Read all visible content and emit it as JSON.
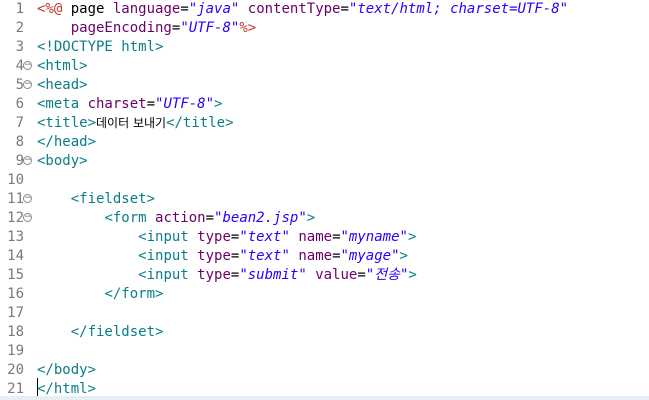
{
  "editor": {
    "lines": [
      {
        "n": "1",
        "fold": false,
        "tokens": [
          [
            "dir",
            "<%@"
          ],
          [
            "txt",
            " page "
          ],
          [
            "attr",
            "language"
          ],
          [
            "txt",
            "="
          ],
          [
            "str",
            "\"java\""
          ],
          [
            "txt",
            " "
          ],
          [
            "attr",
            "contentType"
          ],
          [
            "txt",
            "="
          ],
          [
            "str",
            "\"text/html; charset=UTF-8\""
          ]
        ]
      },
      {
        "n": "2",
        "fold": false,
        "tokens": [
          [
            "txt",
            "    "
          ],
          [
            "attr",
            "pageEncoding"
          ],
          [
            "txt",
            "="
          ],
          [
            "str",
            "\"UTF-8\""
          ],
          [
            "dir",
            "%>"
          ]
        ]
      },
      {
        "n": "3",
        "fold": false,
        "tokens": [
          [
            "tag",
            "<!DOCTYPE html>"
          ]
        ]
      },
      {
        "n": "4",
        "fold": true,
        "tokens": [
          [
            "tag",
            "<html>"
          ]
        ]
      },
      {
        "n": "5",
        "fold": true,
        "tokens": [
          [
            "tag",
            "<head>"
          ]
        ]
      },
      {
        "n": "6",
        "fold": false,
        "tokens": [
          [
            "tag",
            "<meta "
          ],
          [
            "attr",
            "charset"
          ],
          [
            "txt",
            "="
          ],
          [
            "str",
            "\"UTF-8\""
          ],
          [
            "tag",
            ">"
          ]
        ]
      },
      {
        "n": "7",
        "fold": false,
        "tokens": [
          [
            "tag",
            "<title>"
          ],
          [
            "kor",
            "데이터 보내기"
          ],
          [
            "tag",
            "</title>"
          ]
        ]
      },
      {
        "n": "8",
        "fold": false,
        "tokens": [
          [
            "tag",
            "</head>"
          ]
        ]
      },
      {
        "n": "9",
        "fold": true,
        "tokens": [
          [
            "tag",
            "<body>"
          ]
        ]
      },
      {
        "n": "10",
        "fold": false,
        "tokens": []
      },
      {
        "n": "11",
        "fold": true,
        "tokens": [
          [
            "txt",
            "    "
          ],
          [
            "tag",
            "<fieldset>"
          ]
        ]
      },
      {
        "n": "12",
        "fold": true,
        "tokens": [
          [
            "txt",
            "        "
          ],
          [
            "tag",
            "<form "
          ],
          [
            "attr",
            "action"
          ],
          [
            "txt",
            "="
          ],
          [
            "str",
            "\"bean2.jsp\""
          ],
          [
            "tag",
            ">"
          ]
        ]
      },
      {
        "n": "13",
        "fold": false,
        "tokens": [
          [
            "txt",
            "            "
          ],
          [
            "tag",
            "<input "
          ],
          [
            "attr",
            "type"
          ],
          [
            "txt",
            "="
          ],
          [
            "str",
            "\"text\""
          ],
          [
            "txt",
            " "
          ],
          [
            "attr",
            "name"
          ],
          [
            "txt",
            "="
          ],
          [
            "str",
            "\"myname\""
          ],
          [
            "tag",
            ">"
          ]
        ]
      },
      {
        "n": "14",
        "fold": false,
        "tokens": [
          [
            "txt",
            "            "
          ],
          [
            "tag",
            "<input "
          ],
          [
            "attr",
            "type"
          ],
          [
            "txt",
            "="
          ],
          [
            "str",
            "\"text\""
          ],
          [
            "txt",
            " "
          ],
          [
            "attr",
            "name"
          ],
          [
            "txt",
            "="
          ],
          [
            "str",
            "\"myage\""
          ],
          [
            "tag",
            ">"
          ]
        ]
      },
      {
        "n": "15",
        "fold": false,
        "tokens": [
          [
            "txt",
            "            "
          ],
          [
            "tag",
            "<input "
          ],
          [
            "attr",
            "type"
          ],
          [
            "txt",
            "="
          ],
          [
            "str",
            "\"submit\""
          ],
          [
            "txt",
            " "
          ],
          [
            "attr",
            "value"
          ],
          [
            "txt",
            "="
          ],
          [
            "str",
            "\"전송\""
          ],
          [
            "tag",
            ">"
          ]
        ]
      },
      {
        "n": "16",
        "fold": false,
        "tokens": [
          [
            "txt",
            "        "
          ],
          [
            "tag",
            "</form>"
          ]
        ]
      },
      {
        "n": "17",
        "fold": false,
        "tokens": []
      },
      {
        "n": "18",
        "fold": false,
        "tokens": [
          [
            "txt",
            "    "
          ],
          [
            "tag",
            "</fieldset>"
          ]
        ]
      },
      {
        "n": "19",
        "fold": false,
        "tokens": []
      },
      {
        "n": "20",
        "fold": false,
        "tokens": [
          [
            "tag",
            "</body>"
          ]
        ]
      },
      {
        "n": "21",
        "fold": false,
        "tokens": [
          [
            "tag",
            "</html>"
          ]
        ]
      }
    ]
  },
  "colors": {
    "tag": "#0b7d87",
    "directive": "#c0392b",
    "attribute": "#6a006a",
    "string": "#2a00ff",
    "line_number": "#7a7a7a"
  },
  "icons": {
    "fold": "collapse-fold-icon"
  }
}
